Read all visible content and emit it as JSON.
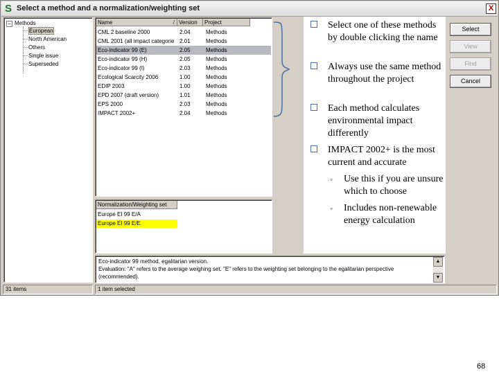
{
  "window": {
    "app_icon": "S",
    "title": "Select a method and a normalization/weighting set",
    "close_glyph": "X"
  },
  "tree": {
    "expander": "−",
    "root": "Methods",
    "children": [
      "European",
      "North American",
      "Others",
      "Single issue",
      "Superseded"
    ],
    "selected_index": 0
  },
  "methods_table": {
    "columns": [
      "Name",
      "Version",
      "Project"
    ],
    "sort_glyph": "/",
    "rows": [
      {
        "name": "CML 2 baseline 2000",
        "version": "2.04",
        "project": "Methods"
      },
      {
        "name": "CML 2001 (all impact categorie",
        "version": "2.01",
        "project": "Methods"
      },
      {
        "name": "Eco-indicator 99 (E)",
        "version": "2.05",
        "project": "Methods"
      },
      {
        "name": "Eco-indicator 99 (H)",
        "version": "2.05",
        "project": "Methods"
      },
      {
        "name": "Eco-indicator 99 (I)",
        "version": "2.03",
        "project": "Methods"
      },
      {
        "name": "Ecological Scarcity 2006",
        "version": "1.00",
        "project": "Methods"
      },
      {
        "name": "EDIP 2003",
        "version": "1.00",
        "project": "Methods"
      },
      {
        "name": "EPD 2007 (draft version)",
        "version": "1.01",
        "project": "Methods"
      },
      {
        "name": "EPS 2000",
        "version": "2.03",
        "project": "Methods"
      },
      {
        "name": "IMPACT 2002+",
        "version": "2.04",
        "project": "Methods"
      }
    ],
    "selected_index": 2
  },
  "norm_table": {
    "header": "Normalization/Weighting set",
    "rows": [
      "Europe EI 99 E/A",
      "Europe EI 99 E/E"
    ],
    "selected_index": 1
  },
  "description": {
    "lines": [
      "Eco-indicator 99 method, egalitarian version.",
      "Evaluation: \"A\" refers to the average weighing set. \"E\" refers to the weighting set belonging to the egalitarian perspective",
      "(recommended)."
    ],
    "scroll_up": "▲",
    "scroll_down": "▼"
  },
  "buttons": [
    {
      "label": "Select",
      "enabled": true
    },
    {
      "label": "View",
      "enabled": false
    },
    {
      "label": "Find",
      "enabled": false
    },
    {
      "label": "Cancel",
      "enabled": true
    }
  ],
  "status": {
    "left": "31 items",
    "right": "1 item selected"
  },
  "slide_notes": {
    "bullet_glyph": "❑",
    "sub_glyph": "◦",
    "bullets": [
      "Select one of these methods by double clicking the name",
      "Always use the same method throughout the project",
      "Each method calculates environmental impact differently",
      "IMPACT 2002+ is the most current and accurate"
    ],
    "sub_bullets": [
      "Use this if you are unsure which to choose",
      "Includes non-renewable energy calculation"
    ]
  },
  "page_number": "68",
  "colors": {
    "selected_row": "#b8b8c0",
    "highlighted_norm": "#ffff00",
    "window_bg": "#d4d0c8",
    "bracket": "#4a6fa5"
  }
}
